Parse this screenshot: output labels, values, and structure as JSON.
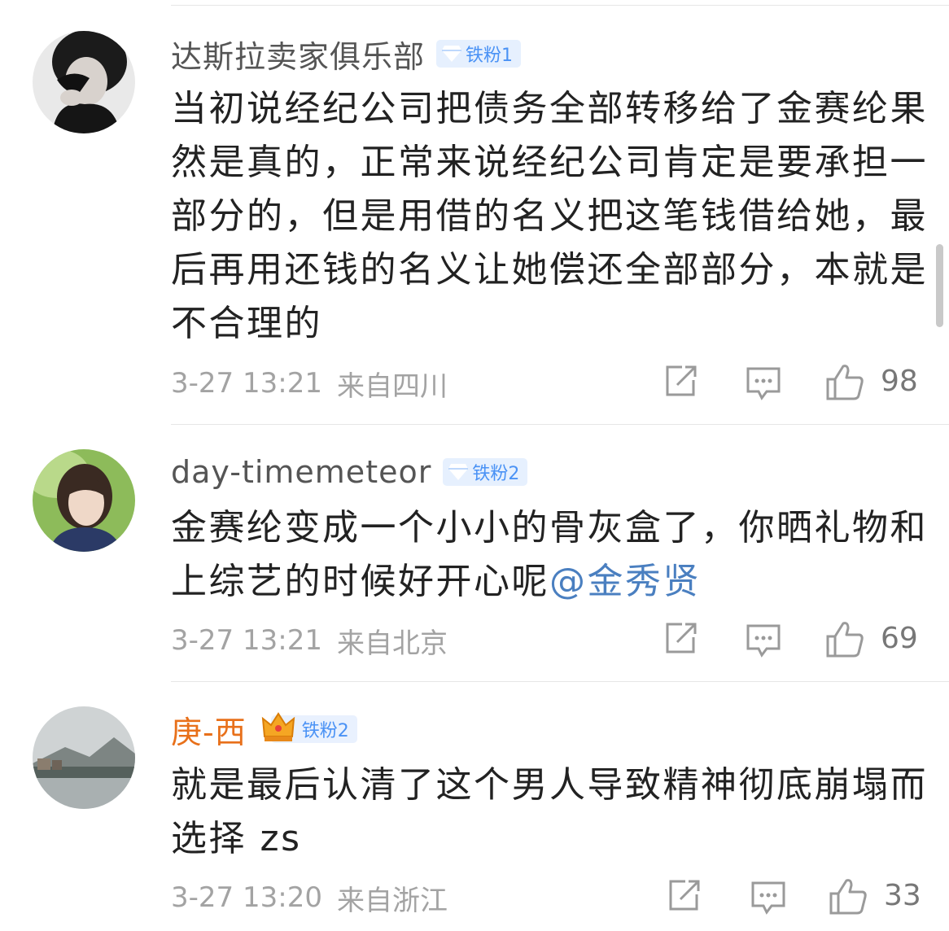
{
  "comments": [
    {
      "username": "达斯拉卖家俱乐部",
      "badge": "铁粉1",
      "badge_icon": "diamond-icon",
      "text": "当初说经纪公司把债务全部转移给了金赛纶果然是真的，正常来说经纪公司肯定是要承担一部分的，但是用借的名义把这笔钱借给她，最后再用还钱的名义让她偿还全部部分，本就是不合理的",
      "mention": "",
      "time": "3-27 13:21",
      "location": "来自四川",
      "likes": "98"
    },
    {
      "username": "day-timemeteor",
      "badge": "铁粉2",
      "badge_icon": "diamond-icon",
      "text": "金赛纶变成一个小小的骨灰盒了，你晒礼物和上综艺的时候好开心呢",
      "mention": "@金秀贤",
      "time": "3-27 13:21",
      "location": "来自北京",
      "likes": "69"
    },
    {
      "username": "庚-西",
      "badge": "铁粉2",
      "badge_icon": "crown-icon",
      "text": "就是最后认清了这个男人导致精神彻底崩塌而选择 zs",
      "mention": "",
      "time": "3-27 13:20",
      "location": "来自浙江",
      "likes": "33"
    }
  ],
  "colors": {
    "username": "#555555",
    "vip_username": "#e8701a",
    "text": "#222222",
    "mention": "#4a7fc0",
    "meta": "#a3a3a3",
    "badge_text": "#4a92f5",
    "badge_bg": "#e6f0fe"
  },
  "icons": {
    "share": "share-icon",
    "comment": "comment-icon",
    "like": "thumbs-up-icon"
  }
}
